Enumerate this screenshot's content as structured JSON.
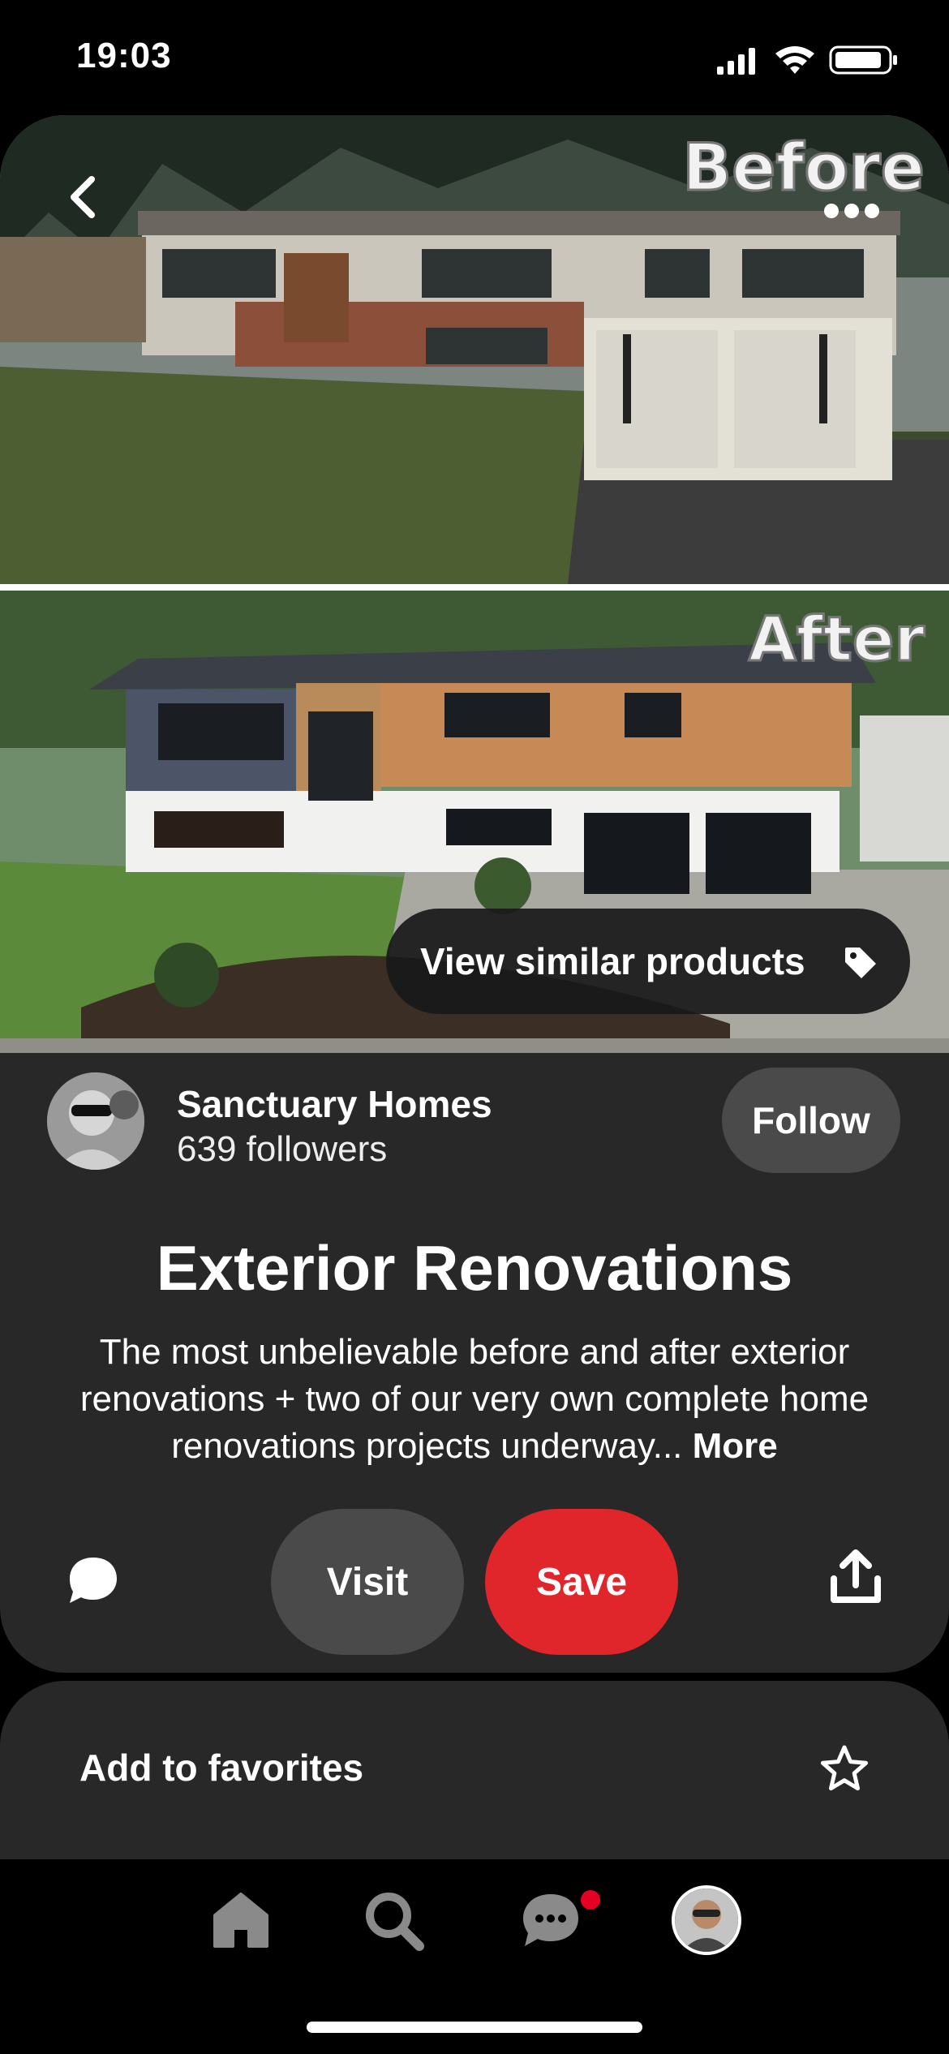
{
  "status_bar": {
    "time": "19:03"
  },
  "pin": {
    "image_labels": {
      "before": "Before",
      "after": "After"
    },
    "similar_products_label": "View similar products",
    "title": "Exterior Renovations",
    "description": "The most unbelievable before and after exterior renovations + two of our very own complete home renovations projects underway...",
    "more_label": "More"
  },
  "creator": {
    "name": "Sanctuary Homes",
    "followers": "639 followers",
    "follow_label": "Follow"
  },
  "actions": {
    "visit_label": "Visit",
    "save_label": "Save"
  },
  "favorites": {
    "label": "Add to favorites"
  },
  "colors": {
    "save_red": "#e0262b",
    "card_bg": "#282828",
    "button_gray": "#4a4a4a",
    "notification": "#e60023"
  },
  "icons": [
    "back-icon",
    "more-icon",
    "tag-icon",
    "comment-icon",
    "share-icon",
    "star-icon",
    "home-icon",
    "search-icon",
    "messages-icon"
  ]
}
